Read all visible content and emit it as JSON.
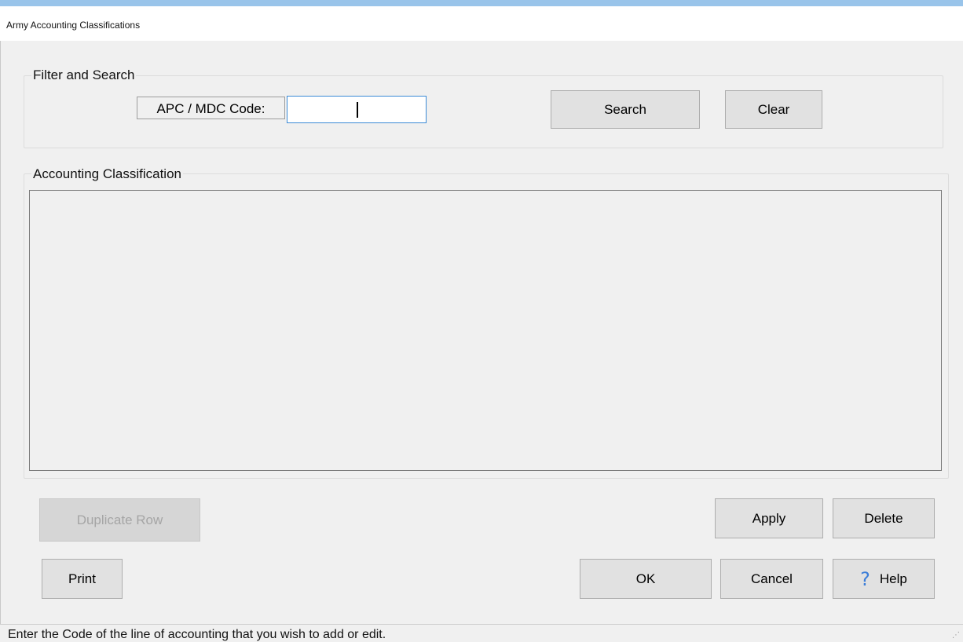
{
  "window": {
    "title": "Army Accounting Classifications"
  },
  "filter": {
    "group_label": "Filter and Search",
    "code_label": "APC / MDC Code:",
    "code_value": "",
    "search_label": "Search",
    "clear_label": "Clear"
  },
  "classification": {
    "group_label": "Accounting Classification",
    "rows": []
  },
  "buttons": {
    "duplicate_row": "Duplicate Row",
    "apply": "Apply",
    "delete": "Delete",
    "print": "Print",
    "ok": "OK",
    "cancel": "Cancel",
    "help": "Help"
  },
  "icons": {
    "help": "question-mark-icon",
    "resize": "resize-grip-icon"
  },
  "status": {
    "text": "Enter the Code of the line of accounting that you wish to add or edit."
  },
  "colors": {
    "window_bg": "#f0f0f0",
    "focus_border": "#3b8ad6",
    "help_icon": "#3b7dd8"
  }
}
